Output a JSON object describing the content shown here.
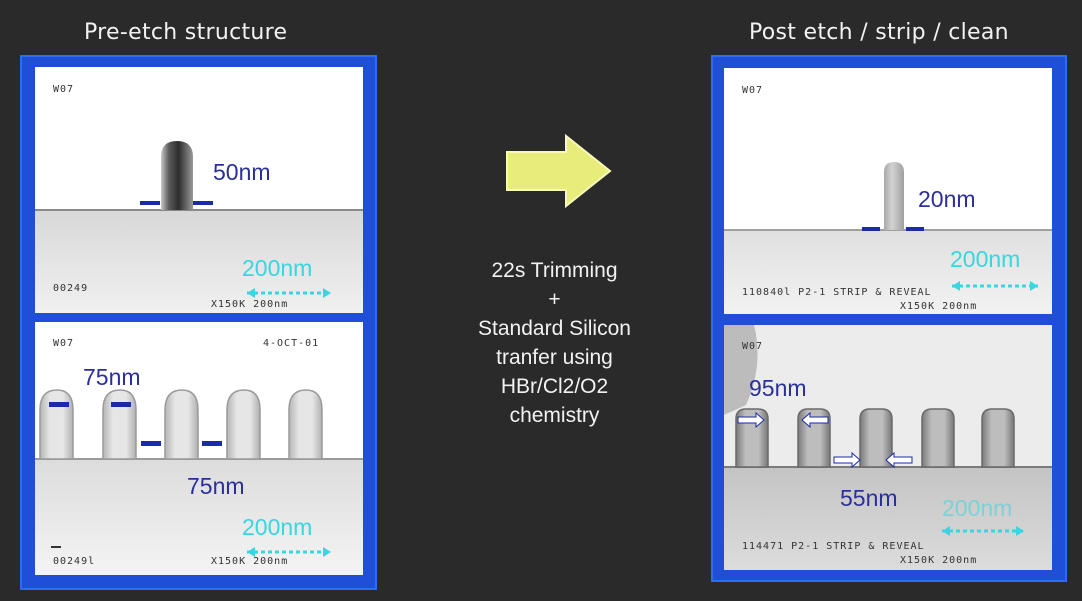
{
  "headings": {
    "left": "Pre-etch structure",
    "right": "Post etch / strip / clean"
  },
  "process": {
    "lines": [
      "22s Trimming",
      "+",
      "Standard Silicon",
      "tranfer using",
      "HBr/Cl2/O2",
      "chemistry"
    ],
    "arrow_icon": "right-arrow-icon",
    "arrow_color": "#e7ec7a"
  },
  "panels": {
    "pre_top": {
      "tag_tl": "W07",
      "tag_bl": "00249",
      "tag_br": "X150K  200nm",
      "dim": "50nm",
      "scale": "200nm"
    },
    "pre_bottom": {
      "tag_tl": "W07",
      "tag_tr": "4-OCT-01",
      "tag_bl": "00249l",
      "tag_br": "X150K  200nm",
      "dim_top": "75nm",
      "dim_bottom": "75nm",
      "scale": "200nm"
    },
    "post_top": {
      "tag_tl": "W07",
      "tag_bl": "110840l  P2-1  STRIP & REVEAL",
      "tag_br": "X150K  200nm",
      "dim": "20nm",
      "scale": "200nm"
    },
    "post_bottom": {
      "tag_tl": "W07",
      "tag_bl": "114471  P2-1  STRIP & REVEAL",
      "tag_br": "X150K  200nm",
      "dim_top": "95nm",
      "dim_bottom": "55nm",
      "scale": "200nm"
    }
  },
  "colors": {
    "frame": "#1e4fd6",
    "dimension_text": "#2a2f9c",
    "scale_text": "#38d6e0",
    "marker": "#1a2aa8"
  }
}
